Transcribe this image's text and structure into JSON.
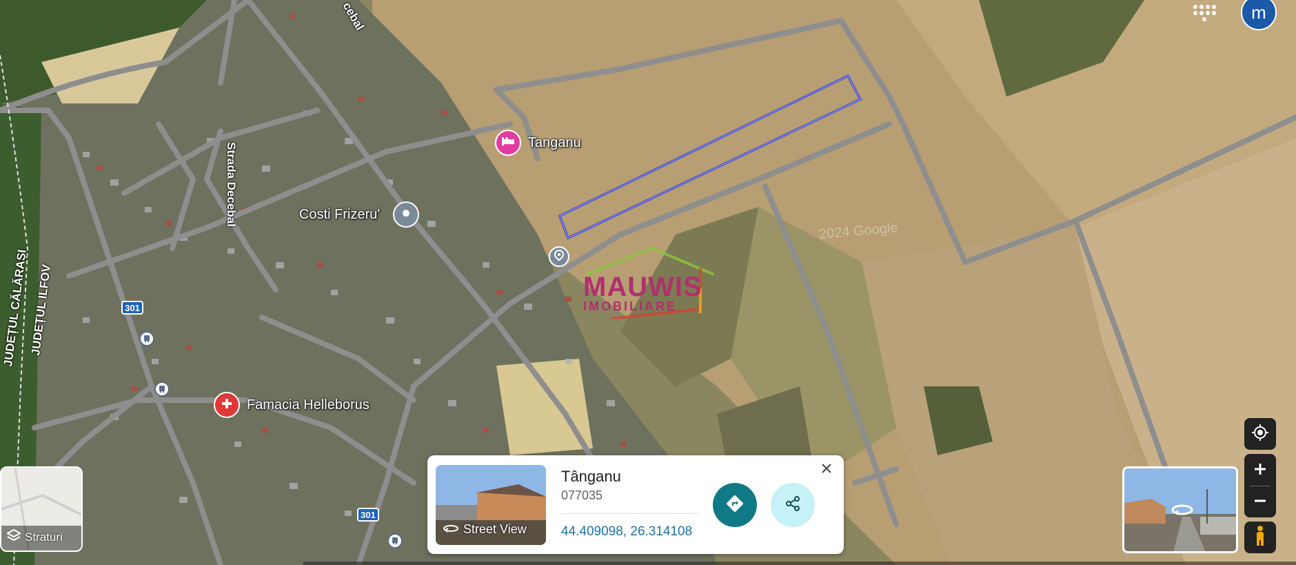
{
  "map": {
    "road_labels": {
      "decebal_top": "cebal",
      "strada_decebal": "Strada Decebal",
      "judet_ilfov": "JUDEȚUL ILFOV",
      "judet_calarasi": "JUDEȚUL CĂLĂRAȘI",
      "faint_text": "2024 Google"
    },
    "pois": {
      "hotel_name": "Tanganu",
      "barber_name": "Costi Frizeru'",
      "pharmacy_name": "Famacia Helleborus"
    },
    "route_shields": {
      "a": "301",
      "b": "301"
    },
    "watermark": {
      "line1": "MAUWIS",
      "line2": "IMOBILIARE"
    }
  },
  "header": {
    "avatar_initial": "m"
  },
  "layers": {
    "label": "Straturi"
  },
  "card": {
    "street_view_label": "Street View",
    "title": "Tânganu",
    "postal_code": "077035",
    "coordinates": "44.409098, 26.314108"
  },
  "colors": {
    "route_outline": "#1c2ad8",
    "avatar_bg": "#1a5aa8",
    "directions_btn": "#0f7a85",
    "share_btn": "#c6f1f6",
    "hotel_pin": "#e33ca0",
    "pharmacy_pin": "#e0393a",
    "place_pin": "#7a8a98"
  },
  "icons": [
    "apps-grid-icon",
    "hotel-icon",
    "place-pin-icon",
    "pharmacy-icon",
    "bus-icon",
    "layers-icon",
    "street-view-360-icon",
    "close-icon",
    "directions-icon",
    "share-icon",
    "my-location-icon",
    "zoom-in-icon",
    "zoom-out-icon",
    "pegman-icon"
  ]
}
